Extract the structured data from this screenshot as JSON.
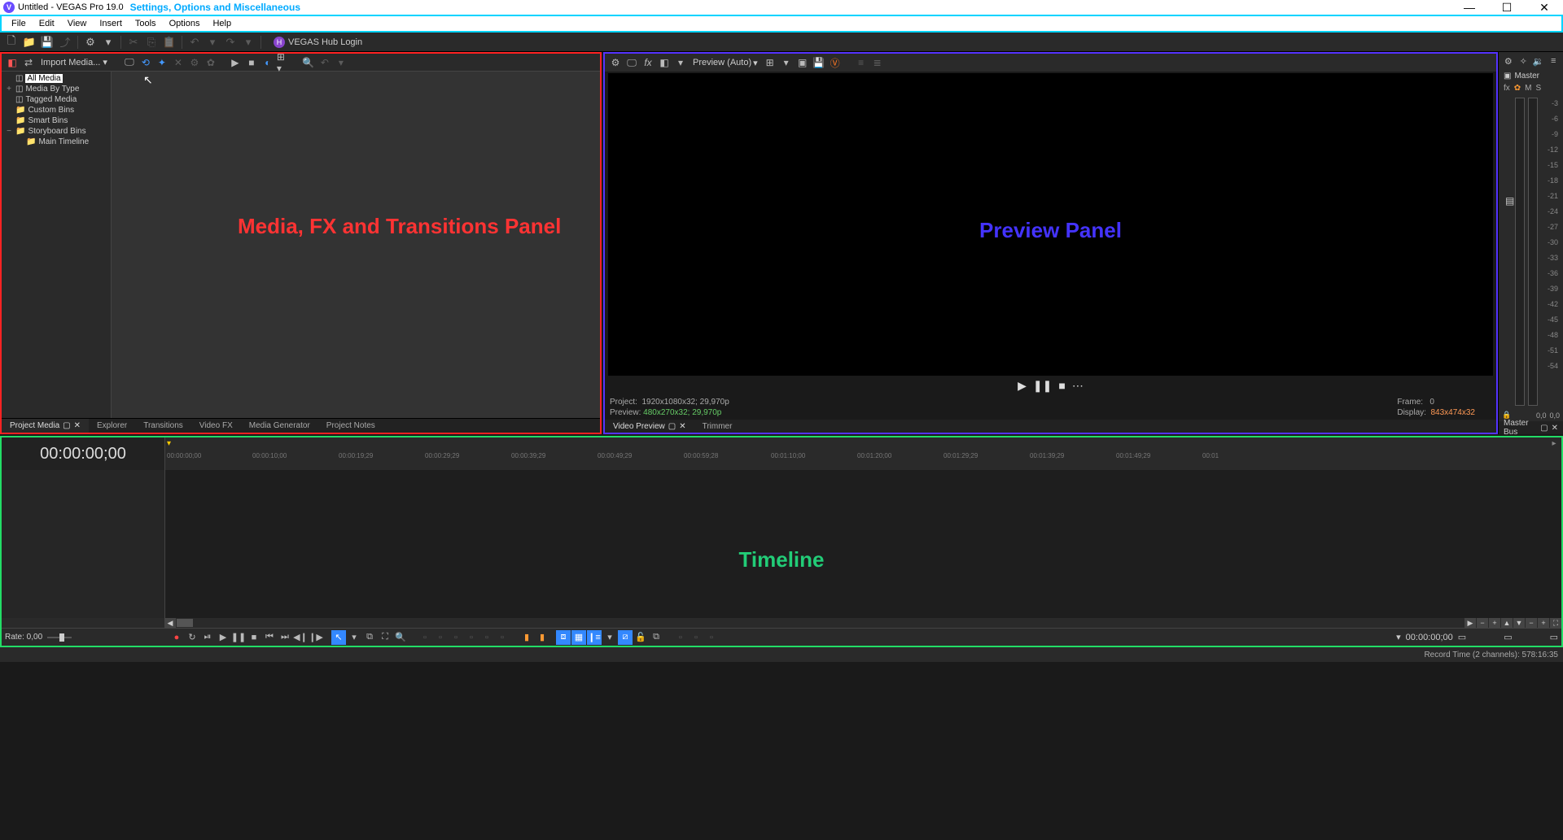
{
  "titlebar": {
    "app_initial": "V",
    "title": "Untitled - VEGAS Pro 19.0",
    "annotation": "Settings, Options and Miscellaneous"
  },
  "menubar": [
    "File",
    "Edit",
    "View",
    "Insert",
    "Tools",
    "Options",
    "Help"
  ],
  "toolbar_hub": "VEGAS Hub Login",
  "media_panel": {
    "import_label": "Import Media...",
    "tree": {
      "all_media": "All Media",
      "by_type": "Media By Type",
      "tagged": "Tagged Media",
      "custom": "Custom Bins",
      "smart": "Smart Bins",
      "storyboard": "Storyboard Bins",
      "main_timeline": "Main Timeline"
    },
    "tabs": [
      "Project Media",
      "Explorer",
      "Transitions",
      "Video FX",
      "Media Generator",
      "Project Notes"
    ],
    "annotation": "Media, FX and Transitions Panel"
  },
  "preview_panel": {
    "preview_mode": "Preview (Auto)",
    "info": {
      "project_label": "Project:",
      "project_value": "1920x1080x32; 29,970p",
      "preview_label": "Preview:",
      "preview_value": "480x270x32; 29,970p",
      "frame_label": "Frame:",
      "frame_value": "0",
      "display_label": "Display:",
      "display_value": "843x474x32"
    },
    "tabs": [
      "Video Preview",
      "Trimmer"
    ],
    "annotation": "Preview Panel"
  },
  "audio_meter": {
    "master": "Master",
    "fx_row": [
      "fx",
      "✿",
      "M",
      "S"
    ],
    "scale": [
      "-3",
      "-6",
      "-9",
      "-12",
      "-15",
      "-18",
      "-21",
      "-24",
      "-27",
      "-30",
      "-33",
      "-36",
      "-39",
      "-42",
      "-45",
      "-48",
      "-51",
      "-54"
    ],
    "foot_left": "0,0",
    "foot_right": "0,0",
    "bus_tab": "Master Bus"
  },
  "timeline": {
    "tc": "00:00:00;00",
    "ruler_ticks": [
      "00:00:00;00",
      "00:00:10;00",
      "00:00:19;29",
      "00:00:29;29",
      "00:00:39;29",
      "00:00:49;29",
      "00:00:59;28",
      "00:01:10;00",
      "00:01:20;00",
      "00:01:29;29",
      "00:01:39;29",
      "00:01:49;29",
      "00:01"
    ],
    "annotation": "Timeline"
  },
  "tl_footer": {
    "rate": "Rate: 0,00",
    "tc_display": "00:00:00;00"
  },
  "statusbar": {
    "record_time": "Record Time (2 channels): 578:16:35"
  }
}
